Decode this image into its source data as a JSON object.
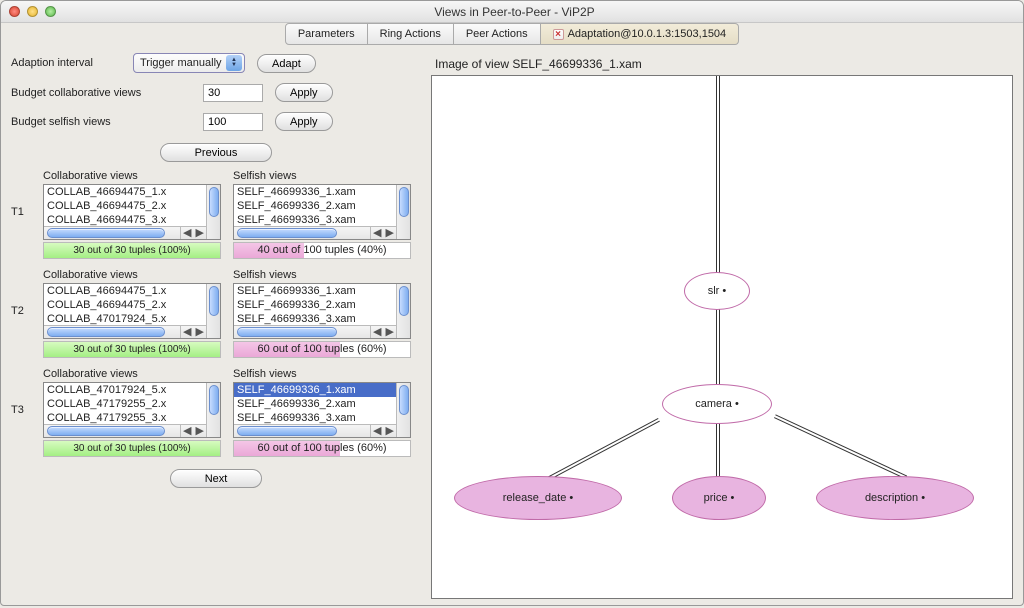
{
  "window_title": "Views in Peer-to-Peer - ViP2P",
  "tabs": [
    {
      "label": "Parameters"
    },
    {
      "label": "Ring Actions"
    },
    {
      "label": "Peer Actions"
    },
    {
      "label": "Adaptation@10.0.1.3:1503,1504"
    }
  ],
  "adaption": {
    "label": "Adaption interval",
    "select_value": "Trigger manually",
    "adapt_btn": "Adapt"
  },
  "budget_collab": {
    "label": "Budget collaborative views",
    "value": "30",
    "apply": "Apply"
  },
  "budget_self": {
    "label": "Budget selfish views",
    "value": "100",
    "apply": "Apply"
  },
  "prev_btn": "Previous",
  "next_btn": "Next",
  "headers": {
    "collab": "Collaborative views",
    "self": "Selfish views"
  },
  "t1": {
    "label": "T1",
    "collab_items": [
      "COLLAB_46694475_1.x",
      "COLLAB_46694475_2.x",
      "COLLAB_46694475_3.x"
    ],
    "self_items": [
      "SELF_46699336_1.xam",
      "SELF_46699336_2.xam",
      "SELF_46699336_3.xam"
    ],
    "collab_status": "30 out of 30 tuples (100%)",
    "self_status": "40 out of 100 tuples (40%)"
  },
  "t2": {
    "label": "T2",
    "collab_items": [
      "COLLAB_46694475_1.x",
      "COLLAB_46694475_2.x",
      "COLLAB_47017924_5.x"
    ],
    "self_items": [
      "SELF_46699336_1.xam",
      "SELF_46699336_2.xam",
      "SELF_46699336_3.xam"
    ],
    "collab_status": "30 out of 30 tuples (100%)",
    "self_status": "60 out of 100 tuples (60%)"
  },
  "t3": {
    "label": "T3",
    "collab_items": [
      "COLLAB_47017924_5.x",
      "COLLAB_47179255_2.x",
      "COLLAB_47179255_3.x"
    ],
    "self_items": [
      "SELF_46699336_1.xam",
      "SELF_46699336_2.xam",
      "SELF_46699336_3.xam"
    ],
    "self_selected": 0,
    "collab_status": "30 out of 30 tuples (100%)",
    "self_status": "60 out of 100 tuples (60%)"
  },
  "diagram": {
    "title": "Image of view SELF_46699336_1.xam",
    "nodes": {
      "slr": "slr •",
      "camera": "camera •",
      "release_date": "release_date •",
      "price": "price •",
      "description": "description •"
    }
  }
}
